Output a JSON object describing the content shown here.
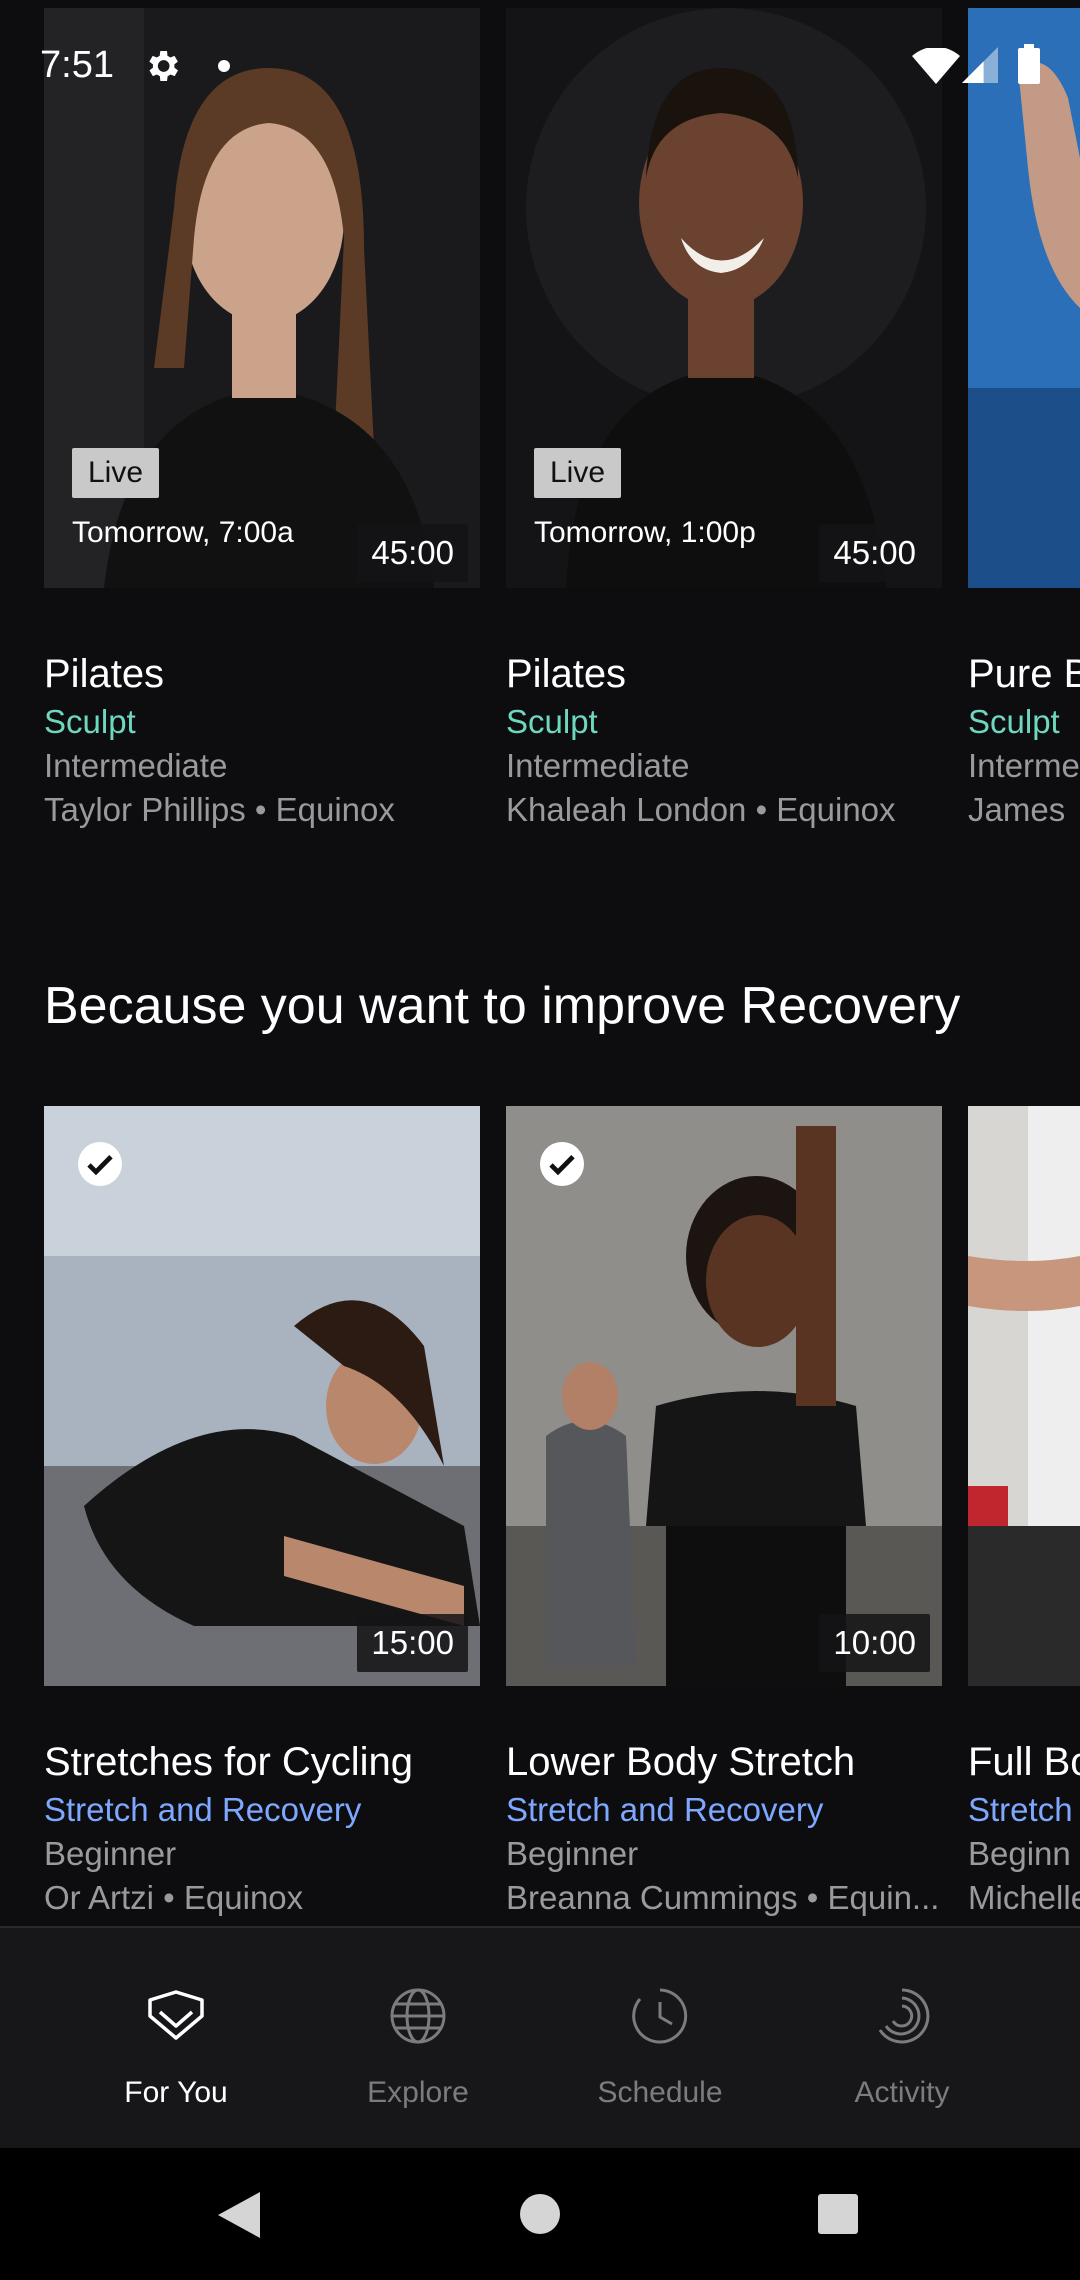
{
  "status_bar": {
    "time": "7:51"
  },
  "live_row": {
    "cards": [
      {
        "badge": "Live",
        "when": "Tomorrow, 7:00a",
        "duration": "45:00",
        "title": "Pilates",
        "category": "Sculpt",
        "level": "Intermediate",
        "instructor": "Taylor Phillips • Equinox"
      },
      {
        "badge": "Live",
        "when": "Tomorrow, 1:00p",
        "duration": "45:00",
        "title": "Pilates",
        "category": "Sculpt",
        "level": "Intermediate",
        "instructor": "Khaleah London • Equinox"
      },
      {
        "title": "Pure B",
        "category": "Sculpt",
        "level": "Interme",
        "instructor": "James"
      }
    ]
  },
  "recovery_section": {
    "title": "Because you want to improve Recovery",
    "cards": [
      {
        "duration": "15:00",
        "title": "Stretches for Cycling",
        "category": "Stretch and Recovery",
        "level": "Beginner",
        "instructor": "Or Artzi • Equinox"
      },
      {
        "duration": "10:00",
        "title": "Lower Body Stretch",
        "category": "Stretch and Recovery",
        "level": "Beginner",
        "instructor": "Breanna Cummings • Equin..."
      },
      {
        "title": "Full Bo",
        "category": "Stretch",
        "level": "Beginn",
        "instructor": "Michelle"
      }
    ]
  },
  "bottom_nav": {
    "items": [
      {
        "label": "For You",
        "icon": "heart-check-icon",
        "active": true
      },
      {
        "label": "Explore",
        "icon": "globe-icon",
        "active": false
      },
      {
        "label": "Schedule",
        "icon": "clock-icon",
        "active": false
      },
      {
        "label": "Activity",
        "icon": "activity-rings-icon",
        "active": false
      }
    ]
  },
  "colors": {
    "background": "#0d0d10",
    "sculpt": "#6dd7bf",
    "stretch": "#7ea8ff",
    "muted": "#9a9a9e"
  }
}
